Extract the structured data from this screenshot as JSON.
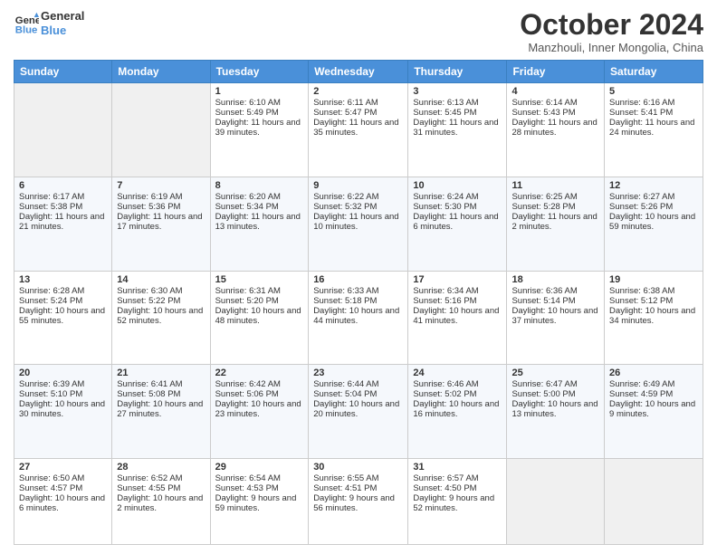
{
  "header": {
    "logo_line1": "General",
    "logo_line2": "Blue",
    "month": "October 2024",
    "location": "Manzhouli, Inner Mongolia, China"
  },
  "days_of_week": [
    "Sunday",
    "Monday",
    "Tuesday",
    "Wednesday",
    "Thursday",
    "Friday",
    "Saturday"
  ],
  "weeks": [
    [
      {
        "day": "",
        "content": ""
      },
      {
        "day": "",
        "content": ""
      },
      {
        "day": "1",
        "content": "Sunrise: 6:10 AM\nSunset: 5:49 PM\nDaylight: 11 hours and 39 minutes."
      },
      {
        "day": "2",
        "content": "Sunrise: 6:11 AM\nSunset: 5:47 PM\nDaylight: 11 hours and 35 minutes."
      },
      {
        "day": "3",
        "content": "Sunrise: 6:13 AM\nSunset: 5:45 PM\nDaylight: 11 hours and 31 minutes."
      },
      {
        "day": "4",
        "content": "Sunrise: 6:14 AM\nSunset: 5:43 PM\nDaylight: 11 hours and 28 minutes."
      },
      {
        "day": "5",
        "content": "Sunrise: 6:16 AM\nSunset: 5:41 PM\nDaylight: 11 hours and 24 minutes."
      }
    ],
    [
      {
        "day": "6",
        "content": "Sunrise: 6:17 AM\nSunset: 5:38 PM\nDaylight: 11 hours and 21 minutes."
      },
      {
        "day": "7",
        "content": "Sunrise: 6:19 AM\nSunset: 5:36 PM\nDaylight: 11 hours and 17 minutes."
      },
      {
        "day": "8",
        "content": "Sunrise: 6:20 AM\nSunset: 5:34 PM\nDaylight: 11 hours and 13 minutes."
      },
      {
        "day": "9",
        "content": "Sunrise: 6:22 AM\nSunset: 5:32 PM\nDaylight: 11 hours and 10 minutes."
      },
      {
        "day": "10",
        "content": "Sunrise: 6:24 AM\nSunset: 5:30 PM\nDaylight: 11 hours and 6 minutes."
      },
      {
        "day": "11",
        "content": "Sunrise: 6:25 AM\nSunset: 5:28 PM\nDaylight: 11 hours and 2 minutes."
      },
      {
        "day": "12",
        "content": "Sunrise: 6:27 AM\nSunset: 5:26 PM\nDaylight: 10 hours and 59 minutes."
      }
    ],
    [
      {
        "day": "13",
        "content": "Sunrise: 6:28 AM\nSunset: 5:24 PM\nDaylight: 10 hours and 55 minutes."
      },
      {
        "day": "14",
        "content": "Sunrise: 6:30 AM\nSunset: 5:22 PM\nDaylight: 10 hours and 52 minutes."
      },
      {
        "day": "15",
        "content": "Sunrise: 6:31 AM\nSunset: 5:20 PM\nDaylight: 10 hours and 48 minutes."
      },
      {
        "day": "16",
        "content": "Sunrise: 6:33 AM\nSunset: 5:18 PM\nDaylight: 10 hours and 44 minutes."
      },
      {
        "day": "17",
        "content": "Sunrise: 6:34 AM\nSunset: 5:16 PM\nDaylight: 10 hours and 41 minutes."
      },
      {
        "day": "18",
        "content": "Sunrise: 6:36 AM\nSunset: 5:14 PM\nDaylight: 10 hours and 37 minutes."
      },
      {
        "day": "19",
        "content": "Sunrise: 6:38 AM\nSunset: 5:12 PM\nDaylight: 10 hours and 34 minutes."
      }
    ],
    [
      {
        "day": "20",
        "content": "Sunrise: 6:39 AM\nSunset: 5:10 PM\nDaylight: 10 hours and 30 minutes."
      },
      {
        "day": "21",
        "content": "Sunrise: 6:41 AM\nSunset: 5:08 PM\nDaylight: 10 hours and 27 minutes."
      },
      {
        "day": "22",
        "content": "Sunrise: 6:42 AM\nSunset: 5:06 PM\nDaylight: 10 hours and 23 minutes."
      },
      {
        "day": "23",
        "content": "Sunrise: 6:44 AM\nSunset: 5:04 PM\nDaylight: 10 hours and 20 minutes."
      },
      {
        "day": "24",
        "content": "Sunrise: 6:46 AM\nSunset: 5:02 PM\nDaylight: 10 hours and 16 minutes."
      },
      {
        "day": "25",
        "content": "Sunrise: 6:47 AM\nSunset: 5:00 PM\nDaylight: 10 hours and 13 minutes."
      },
      {
        "day": "26",
        "content": "Sunrise: 6:49 AM\nSunset: 4:59 PM\nDaylight: 10 hours and 9 minutes."
      }
    ],
    [
      {
        "day": "27",
        "content": "Sunrise: 6:50 AM\nSunset: 4:57 PM\nDaylight: 10 hours and 6 minutes."
      },
      {
        "day": "28",
        "content": "Sunrise: 6:52 AM\nSunset: 4:55 PM\nDaylight: 10 hours and 2 minutes."
      },
      {
        "day": "29",
        "content": "Sunrise: 6:54 AM\nSunset: 4:53 PM\nDaylight: 9 hours and 59 minutes."
      },
      {
        "day": "30",
        "content": "Sunrise: 6:55 AM\nSunset: 4:51 PM\nDaylight: 9 hours and 56 minutes."
      },
      {
        "day": "31",
        "content": "Sunrise: 6:57 AM\nSunset: 4:50 PM\nDaylight: 9 hours and 52 minutes."
      },
      {
        "day": "",
        "content": ""
      },
      {
        "day": "",
        "content": ""
      }
    ]
  ]
}
